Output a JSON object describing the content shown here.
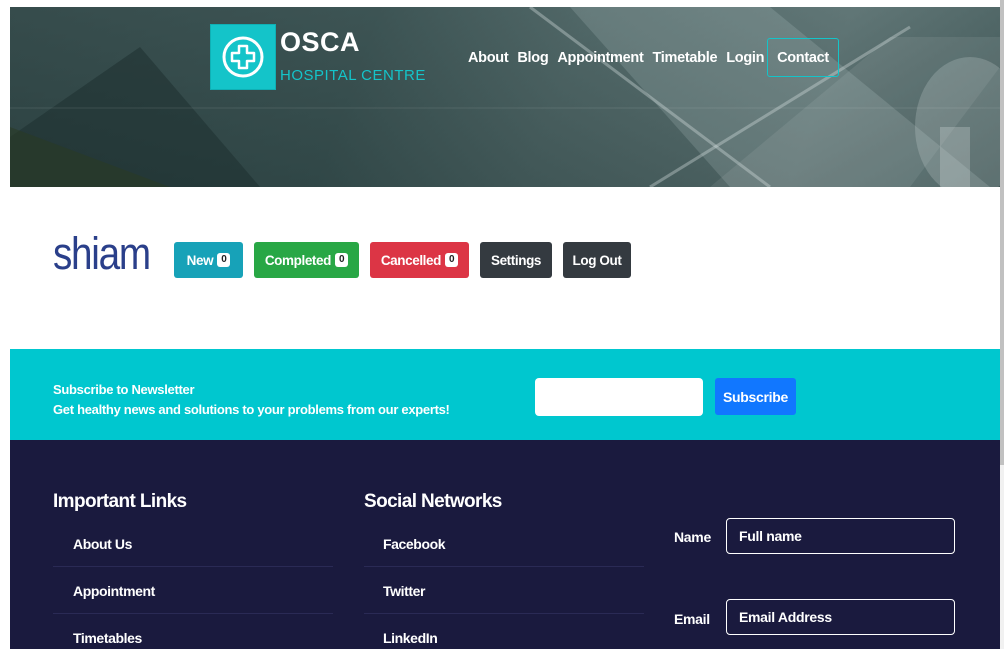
{
  "brand": {
    "name": "OSCA",
    "subtitle": "HOSPITAL CENTRE",
    "icon": "plus-circle-icon"
  },
  "nav": {
    "items": [
      "About",
      "Blog",
      "Appointment",
      "Timetable",
      "Login"
    ],
    "contact": "Contact"
  },
  "user": {
    "name": "shiam",
    "buttons": {
      "new": {
        "label": "New",
        "count": "0",
        "color": "#17a2b8"
      },
      "completed": {
        "label": "Completed",
        "count": "0",
        "color": "#28a745"
      },
      "cancelled": {
        "label": "Cancelled",
        "count": "0",
        "color": "#dc3545"
      },
      "settings": {
        "label": "Settings",
        "color": "#343a40"
      },
      "logout": {
        "label": "Log Out",
        "color": "#343a40"
      }
    }
  },
  "newsletter": {
    "title": "Subscribe to Newsletter",
    "subtitle": "Get healthy news and solutions to your problems from our experts!",
    "input_placeholder": "",
    "button": "Subscribe",
    "bg_color": "#00c7cf"
  },
  "footer": {
    "bg_color": "#1a1a3e",
    "important_links": {
      "title": "Important Links",
      "items": [
        "About Us",
        "Appointment",
        "Timetables"
      ]
    },
    "social": {
      "title": "Social Networks",
      "items": [
        "Facebook",
        "Twitter",
        "LinkedIn"
      ]
    },
    "form": {
      "name_label": "Name",
      "name_placeholder": "Full name",
      "email_label": "Email",
      "email_placeholder": "Email Address"
    }
  }
}
